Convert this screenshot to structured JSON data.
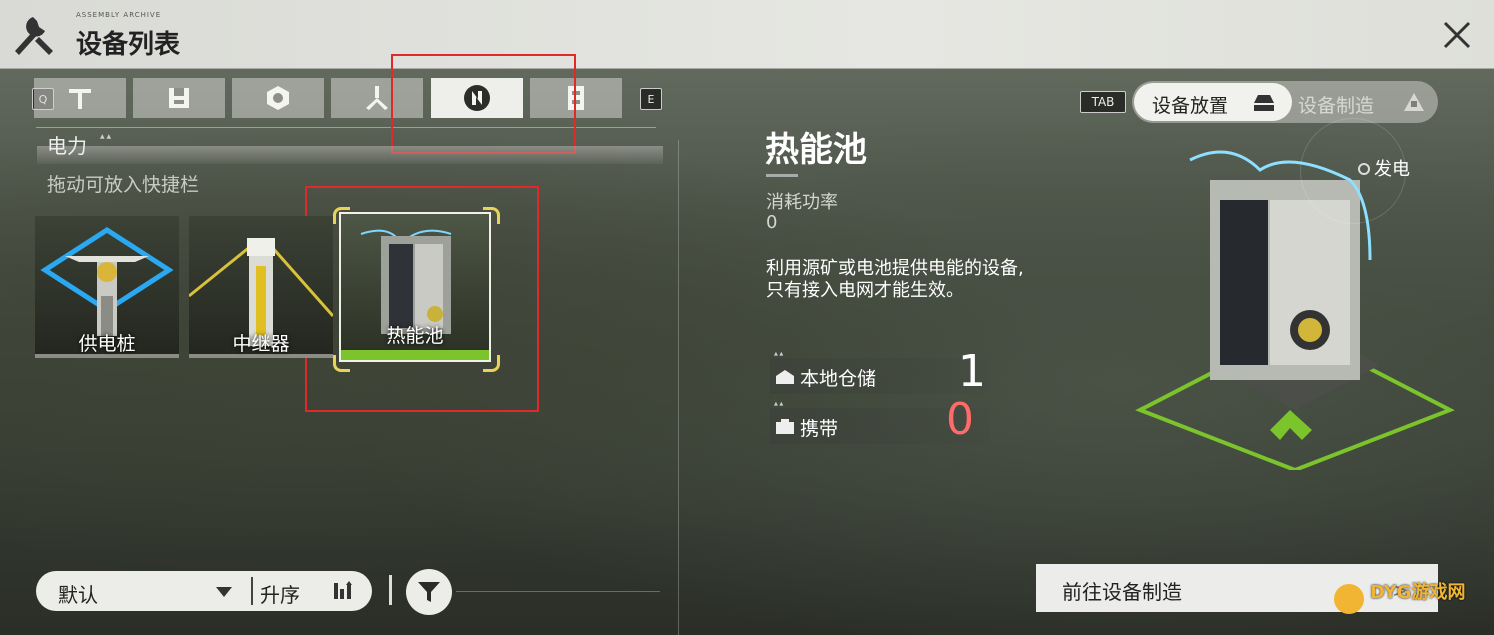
{
  "header": {
    "brand_tag": "ASSEMBLY ARCHIVE",
    "title": "设备列表",
    "close_icon": "close-icon"
  },
  "category_tabs": {
    "prev_key": "Q",
    "next_key": "E",
    "tabs": [
      {
        "icon": "pickaxe-icon",
        "active": false
      },
      {
        "icon": "storage-icon",
        "active": false
      },
      {
        "icon": "gear-nut-icon",
        "active": false
      },
      {
        "icon": "trident-icon",
        "active": false
      },
      {
        "icon": "power-icon",
        "active": true
      },
      {
        "icon": "machine-icon",
        "active": false
      }
    ]
  },
  "section": {
    "title": "电力",
    "hint": "拖动可放入快捷栏"
  },
  "devices": [
    {
      "name": "供电桩",
      "selected": false
    },
    {
      "name": "中继器",
      "selected": false
    },
    {
      "name": "热能池",
      "selected": true
    }
  ],
  "sort": {
    "default_label": "默认",
    "order_label": "升序"
  },
  "mode": {
    "tab_key": "TAB",
    "place_label": "设备放置",
    "craft_label": "设备制造"
  },
  "detail": {
    "name": "热能池",
    "consume_label": "消耗功率",
    "consume_value": "0",
    "description_line1": "利用源矿或电池提供电能的设备,",
    "description_line2": "只有接入电网才能生效。",
    "power_tag": "发电",
    "local_storage_label": "本地仓储",
    "local_storage_value": "1",
    "carry_label": "携带",
    "carry_value": "0",
    "goto_label": "前往设备制造",
    "goto_arrow": ">"
  },
  "colors": {
    "accent_green": "#7bc42c",
    "warn_red": "#ff6b6b",
    "highlight_box": "#e02a2a"
  },
  "watermark": "DYG游戏网"
}
